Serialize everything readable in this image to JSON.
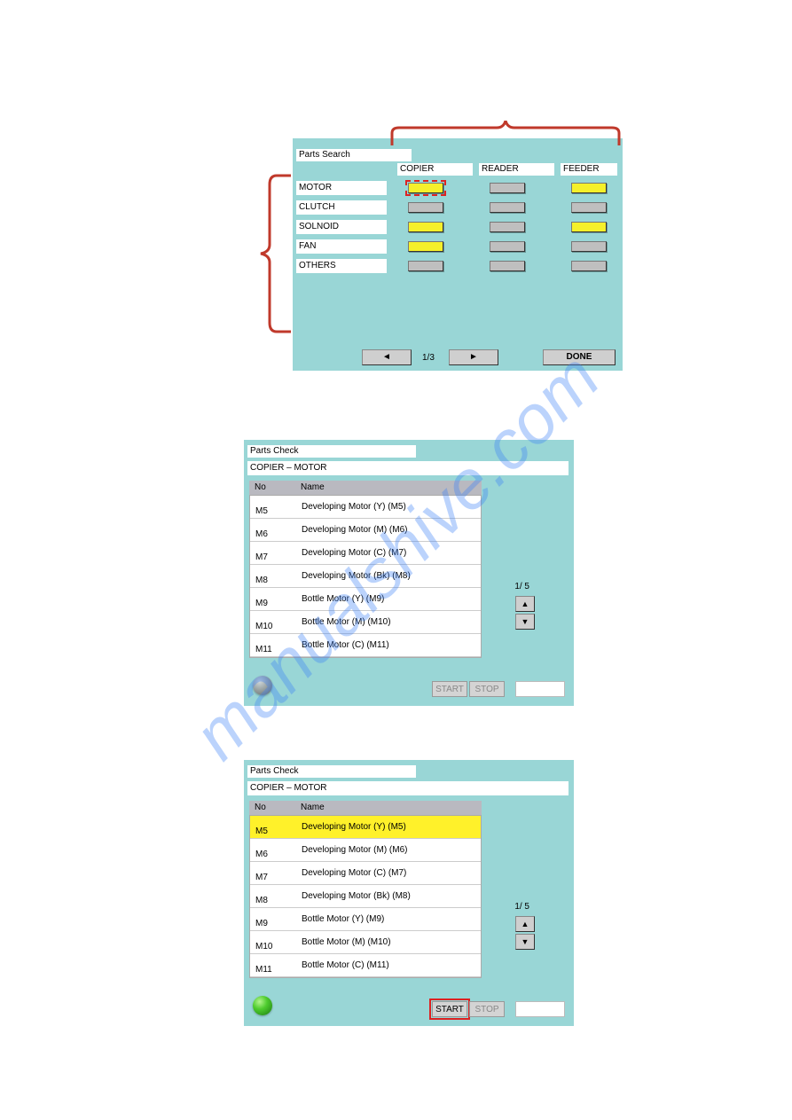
{
  "watermark": "manualshive.com",
  "panel1": {
    "title": "Parts Search",
    "cols": [
      "COPIER",
      "READER",
      "FEEDER"
    ],
    "rows": [
      "MOTOR",
      "CLUTCH",
      "SOLNOID",
      "FAN",
      "OTHERS"
    ],
    "cells": [
      [
        "yellow",
        "grey",
        "yellow"
      ],
      [
        "grey",
        "grey",
        "grey"
      ],
      [
        "yellow",
        "grey",
        "yellow"
      ],
      [
        "yellow",
        "grey",
        "grey"
      ],
      [
        "grey",
        "grey",
        "grey"
      ]
    ],
    "highlight": [
      0,
      0
    ],
    "page": "1/3",
    "prev": "◄",
    "next": "►",
    "done": "DONE"
  },
  "panel2": {
    "title": "Parts Check",
    "subtitle": "COPIER – MOTOR",
    "head_no": "No",
    "head_name": "Name",
    "rows": [
      {
        "no": "M5",
        "name": "Developing Motor (Y) (M5)"
      },
      {
        "no": "M6",
        "name": "Developing Motor (M) (M6)"
      },
      {
        "no": "M7",
        "name": "Developing Motor (C) (M7)"
      },
      {
        "no": "M8",
        "name": "Developing Motor (Bk) (M8)"
      },
      {
        "no": "M9",
        "name": "Bottle Motor (Y) (M9)"
      },
      {
        "no": "M10",
        "name": "Bottle Motor (M) (M10)"
      },
      {
        "no": "M11",
        "name": "Bottle Motor (C) (M11)"
      }
    ],
    "page": "1/ 5",
    "up": "▲",
    "down": "▼",
    "start": "START",
    "stop": "STOP"
  },
  "panel3": {
    "title": "Parts Check",
    "subtitle": "COPIER – MOTOR",
    "head_no": "No",
    "head_name": "Name",
    "rows": [
      {
        "no": "M5",
        "name": "Developing Motor (Y) (M5)",
        "sel": true
      },
      {
        "no": "M6",
        "name": "Developing Motor (M) (M6)"
      },
      {
        "no": "M7",
        "name": "Developing Motor (C) (M7)"
      },
      {
        "no": "M8",
        "name": "Developing Motor (Bk) (M8)"
      },
      {
        "no": "M9",
        "name": "Bottle Motor (Y) (M9)"
      },
      {
        "no": "M10",
        "name": "Bottle Motor (M) (M10)"
      },
      {
        "no": "M11",
        "name": "Bottle Motor (C) (M11)"
      }
    ],
    "page": "1/ 5",
    "up": "▲",
    "down": "▼",
    "start": "START",
    "stop": "STOP"
  }
}
